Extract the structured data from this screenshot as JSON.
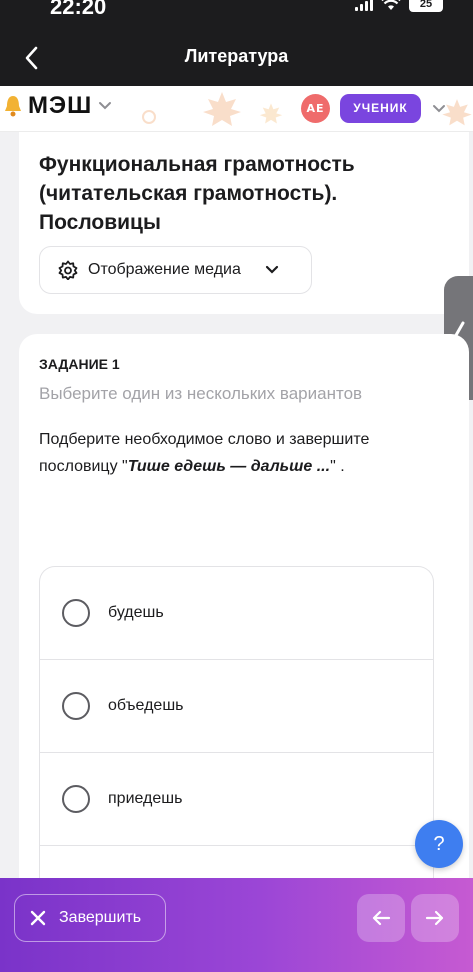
{
  "status_bar": {
    "time": "22:20",
    "battery": "25"
  },
  "nav": {
    "title": "Литература"
  },
  "app_header": {
    "logo_text": "МЭШ",
    "avatar_initials": "АЕ",
    "role": "УЧЕНИК"
  },
  "lesson": {
    "title": "Функциональная грамотность (читательская грамотность). Пословицы",
    "media_button": "Отображение медиа"
  },
  "task": {
    "number_label": "ЗАДАНИЕ 1",
    "hint": "Выберите один из нескольких вариантов",
    "text_before": "Подберите необходимое слово и завершите пословицу \"",
    "text_emphasis": "Тише едешь — дальше ...",
    "text_after": "\" .",
    "options": [
      {
        "label": "будешь"
      },
      {
        "label": "объедешь"
      },
      {
        "label": "приедешь"
      },
      {
        "label": ""
      }
    ]
  },
  "help_button": "?",
  "bottom_bar": {
    "finish_label": "Завершить"
  },
  "colors": {
    "accent": "#7a45df",
    "avatar": "#ef6b6b",
    "help": "#3e7ef0"
  },
  "icons": [
    "back-chevron-icon",
    "bell-icon",
    "chevron-down-icon",
    "gear-icon",
    "close-icon",
    "arrow-left-icon",
    "arrow-right-icon"
  ]
}
